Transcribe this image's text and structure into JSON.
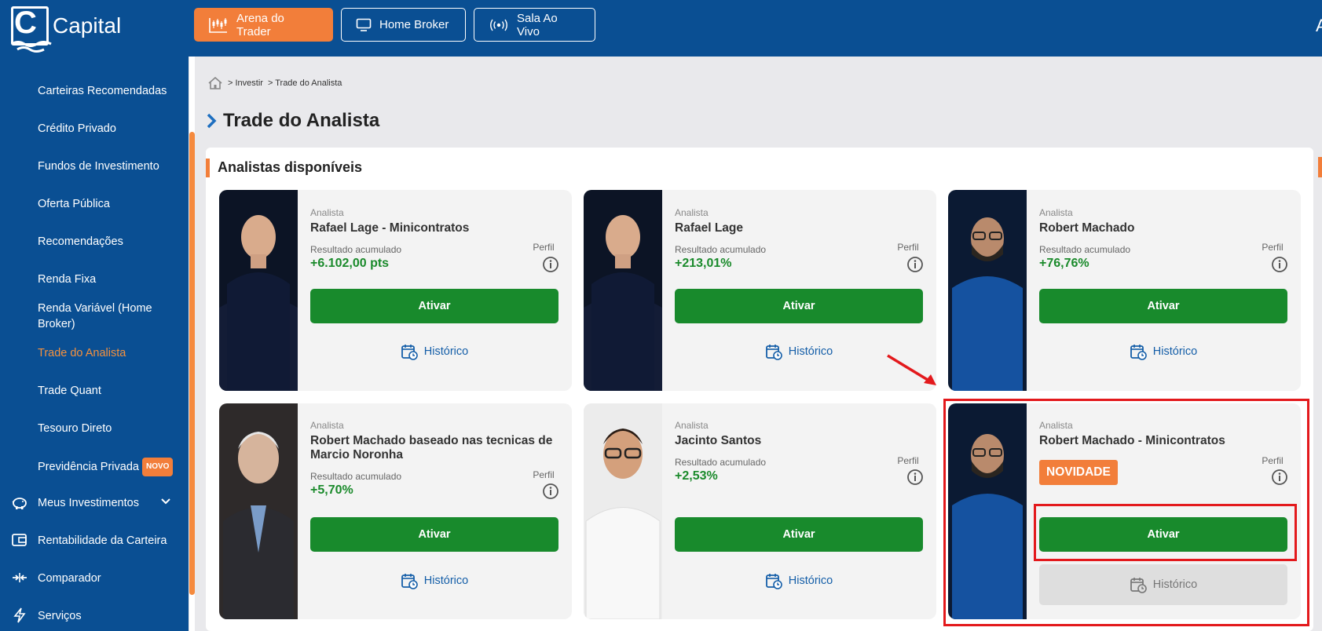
{
  "brand": {
    "name": "Capital",
    "logo_letter": "C"
  },
  "topnav": [
    {
      "label": "Arena do Trader",
      "icon": "chart-candles-icon"
    },
    {
      "label": "Home Broker",
      "icon": "monitor-icon"
    },
    {
      "label": "Sala Ao Vivo",
      "icon": "broadcast-icon"
    }
  ],
  "top_right_fragment": "A",
  "sidebar": {
    "subitems": [
      {
        "label": "Carteiras Recomendadas"
      },
      {
        "label": "Crédito Privado"
      },
      {
        "label": "Fundos de Investimento"
      },
      {
        "label": "Oferta Pública"
      },
      {
        "label": "Recomendações"
      },
      {
        "label": "Renda Fixa"
      },
      {
        "label": "Renda Variável (Home Broker)"
      },
      {
        "label": "Trade do Analista",
        "active": true
      },
      {
        "label": "Trade Quant"
      },
      {
        "label": "Tesouro Direto"
      },
      {
        "label": "Previdência Privada",
        "badge": "NOVO"
      }
    ],
    "sections": [
      {
        "label": "Meus Investimentos",
        "icon": "piggy-bank-icon",
        "expandable": true
      },
      {
        "label": "Rentabilidade da Carteira",
        "icon": "wallet-icon"
      },
      {
        "label": "Comparador",
        "icon": "compare-arrows-icon"
      },
      {
        "label": "Serviços",
        "icon": "lightning-icon"
      }
    ]
  },
  "breadcrumb": [
    "> Investir",
    "> Trade do Analista"
  ],
  "page_title": "Trade do Analista",
  "panel_title": "Analistas disponíveis",
  "labels": {
    "analista": "Analista",
    "resultado": "Resultado acumulado",
    "perfil": "Perfil",
    "ativar": "Ativar",
    "historico": "Histórico"
  },
  "analysts": [
    {
      "name": "Rafael Lage - Minicontratos",
      "result": "+6.102,00 pts"
    },
    {
      "name": "Rafael Lage",
      "result": "+213,01%"
    },
    {
      "name": "Robert Machado",
      "result": "+76,76%"
    },
    {
      "name": "Robert Machado baseado nas tecnicas de Marcio Noronha",
      "result": "+5,70%"
    },
    {
      "name": "Jacinto Santos",
      "result": "+2,53%"
    },
    {
      "name": "Robert Machado - Minicontratos",
      "tag": "NOVIDADE"
    }
  ],
  "colors": {
    "topbar": "#0a4f93",
    "accent_orange": "#f27e3a",
    "button_green": "#188a2c",
    "result_green": "#1a8a2b",
    "highlight_red": "#e3191c"
  }
}
